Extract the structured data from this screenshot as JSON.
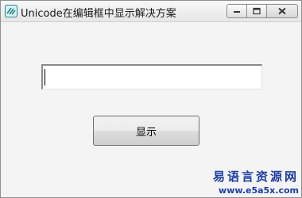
{
  "window": {
    "title": "Unicode在编辑框中显示解决方案",
    "app_icon": "app-logo-icon",
    "controls": [
      "minimize-icon",
      "maximize-icon",
      "close-icon"
    ]
  },
  "editbox": {
    "value": "",
    "placeholder": ""
  },
  "button": {
    "label": "显示"
  },
  "watermark": {
    "name": "易语言资源网",
    "url": "www.e5a5x.com"
  },
  "colors": {
    "watermark": "#1e3da0",
    "client_bg": "#f4f4f4"
  }
}
